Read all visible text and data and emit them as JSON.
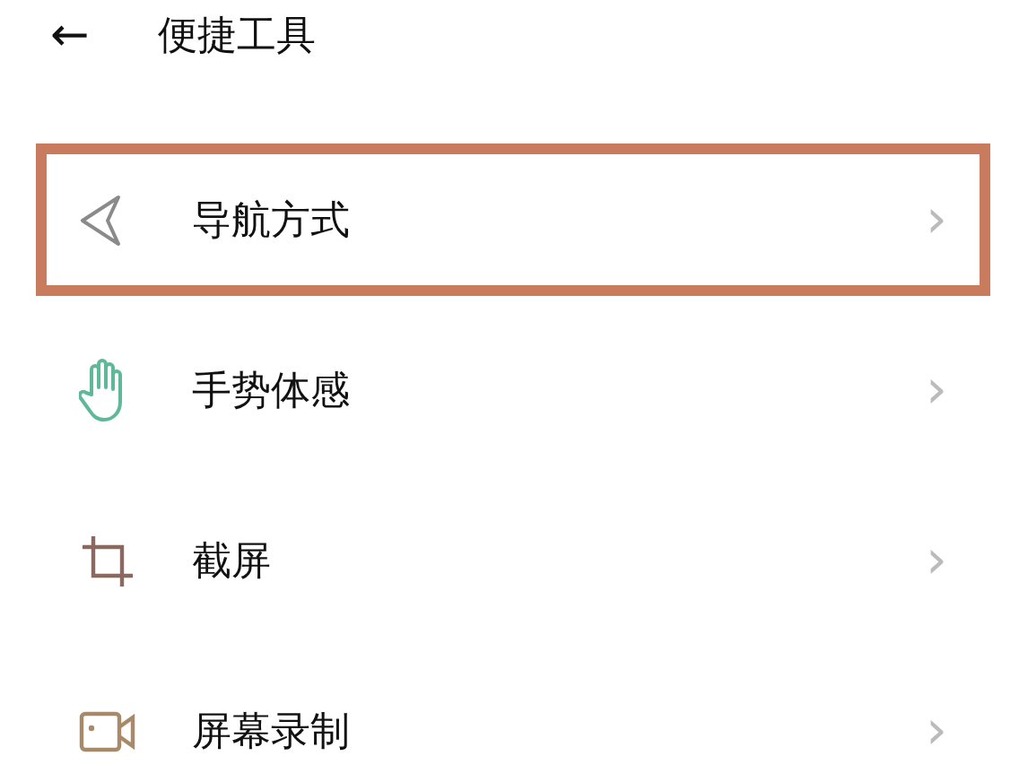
{
  "header": {
    "back": "←",
    "title": "便捷工具"
  },
  "items": [
    {
      "label": "导航方式",
      "chevron": "›",
      "highlighted": true
    },
    {
      "label": "手势体感",
      "chevron": "›",
      "highlighted": false
    },
    {
      "label": "截屏",
      "chevron": "›",
      "highlighted": false
    },
    {
      "label": "屏幕录制",
      "chevron": "›",
      "highlighted": false
    }
  ]
}
